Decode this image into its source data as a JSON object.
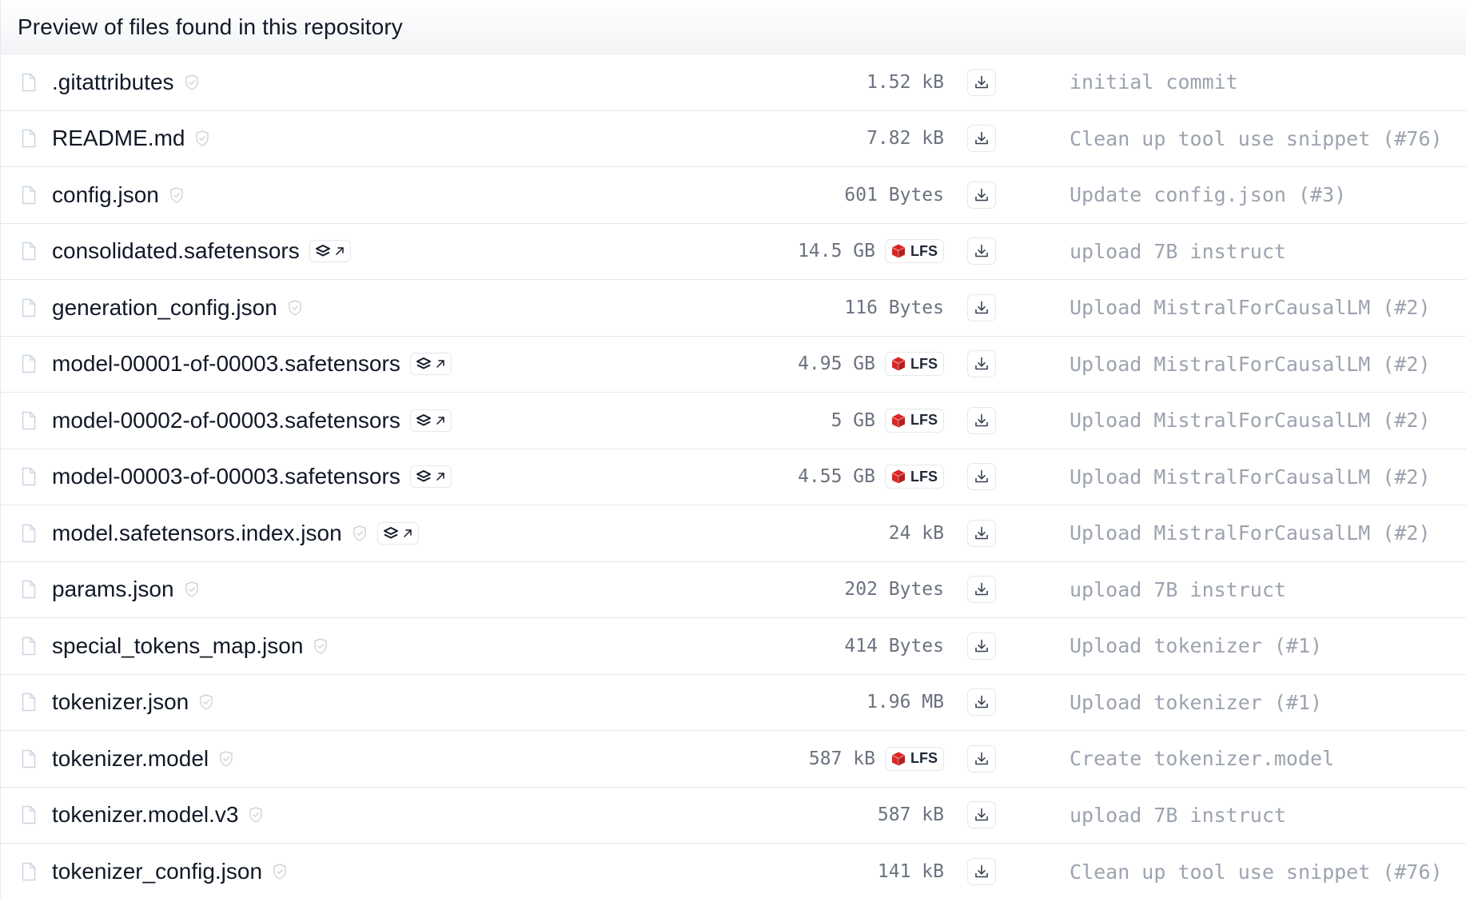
{
  "header": {
    "title": "Preview of files found in this repository"
  },
  "colors": {
    "lfs_cube": "#dc2626",
    "commit_text": "#9ca3af",
    "size_text": "#6b7280",
    "border": "#e5e7eb"
  },
  "icons": {
    "file": "file-icon",
    "safe": "shield-check-icon",
    "xet": "layers-arrow-icon",
    "lfs": "lfs-cube-icon",
    "download": "download-icon"
  },
  "lfs_label": "LFS",
  "files": [
    {
      "name": ".gitattributes",
      "size": "1.52 kB",
      "lfs": false,
      "safe": true,
      "xet": false,
      "commit": "initial commit"
    },
    {
      "name": "README.md",
      "size": "7.82 kB",
      "lfs": false,
      "safe": true,
      "xet": false,
      "commit": "Clean up tool use snippet (#76)"
    },
    {
      "name": "config.json",
      "size": "601 Bytes",
      "lfs": false,
      "safe": true,
      "xet": false,
      "commit": "Update config.json (#3)"
    },
    {
      "name": "consolidated.safetensors",
      "size": "14.5 GB",
      "lfs": true,
      "safe": false,
      "xet": true,
      "commit": "upload 7B instruct"
    },
    {
      "name": "generation_config.json",
      "size": "116 Bytes",
      "lfs": false,
      "safe": true,
      "xet": false,
      "commit": "Upload MistralForCausalLM (#2)"
    },
    {
      "name": "model-00001-of-00003.safetensors",
      "size": "4.95 GB",
      "lfs": true,
      "safe": false,
      "xet": true,
      "commit": "Upload MistralForCausalLM (#2)"
    },
    {
      "name": "model-00002-of-00003.safetensors",
      "size": "5 GB",
      "lfs": true,
      "safe": false,
      "xet": true,
      "commit": "Upload MistralForCausalLM (#2)"
    },
    {
      "name": "model-00003-of-00003.safetensors",
      "size": "4.55 GB",
      "lfs": true,
      "safe": false,
      "xet": true,
      "commit": "Upload MistralForCausalLM (#2)"
    },
    {
      "name": "model.safetensors.index.json",
      "size": "24 kB",
      "lfs": false,
      "safe": true,
      "xet": true,
      "commit": "Upload MistralForCausalLM (#2)"
    },
    {
      "name": "params.json",
      "size": "202 Bytes",
      "lfs": false,
      "safe": true,
      "xet": false,
      "commit": "upload 7B instruct"
    },
    {
      "name": "special_tokens_map.json",
      "size": "414 Bytes",
      "lfs": false,
      "safe": true,
      "xet": false,
      "commit": "Upload tokenizer (#1)"
    },
    {
      "name": "tokenizer.json",
      "size": "1.96 MB",
      "lfs": false,
      "safe": true,
      "xet": false,
      "commit": "Upload tokenizer (#1)"
    },
    {
      "name": "tokenizer.model",
      "size": "587 kB",
      "lfs": true,
      "safe": true,
      "xet": false,
      "commit": "Create tokenizer.model"
    },
    {
      "name": "tokenizer.model.v3",
      "size": "587 kB",
      "lfs": false,
      "safe": true,
      "xet": false,
      "commit": "upload 7B instruct"
    },
    {
      "name": "tokenizer_config.json",
      "size": "141 kB",
      "lfs": false,
      "safe": true,
      "xet": false,
      "commit": "Clean up tool use snippet (#76)"
    }
  ]
}
